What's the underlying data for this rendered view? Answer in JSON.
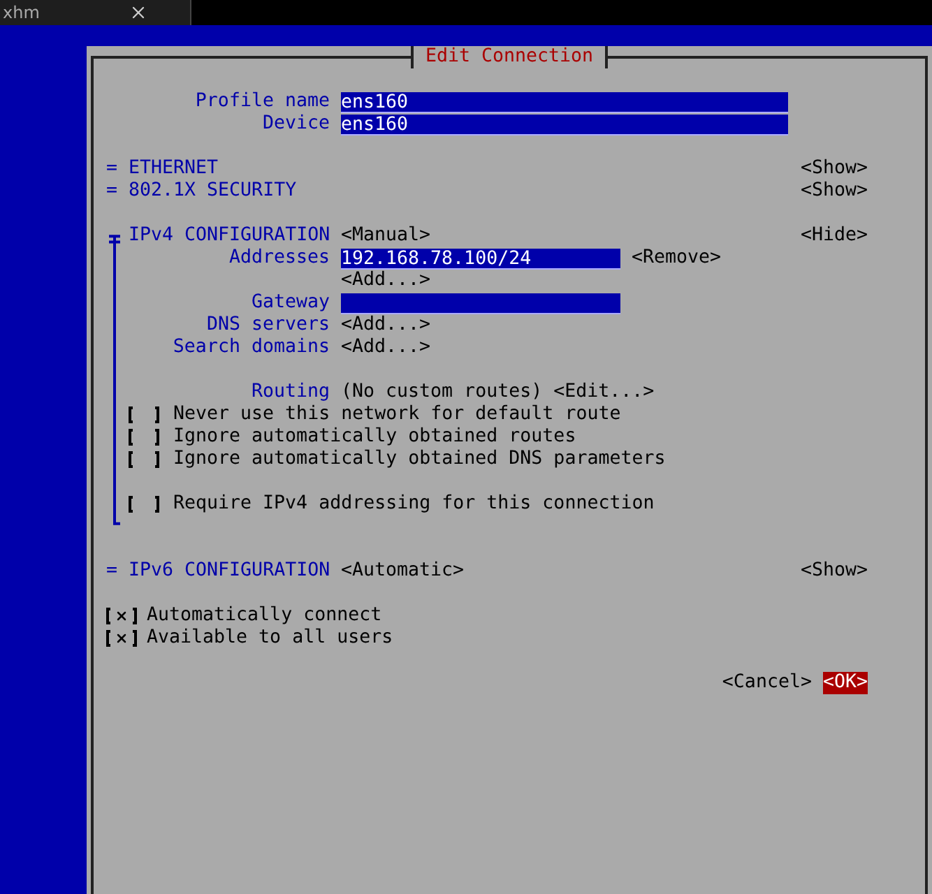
{
  "tab": {
    "title": "xhm"
  },
  "dialog": {
    "title": "Edit Connection",
    "fields": [
      {
        "label": "Profile name",
        "value": "ens160"
      },
      {
        "label": "Device",
        "value": "ens160"
      }
    ],
    "sections": [
      {
        "marker": "=",
        "title": "ETHERNET",
        "toggle": "<Show>",
        "expanded": false
      },
      {
        "marker": "=",
        "title": "802.1X SECURITY",
        "toggle": "<Show>",
        "expanded": false
      }
    ],
    "ipv4": {
      "title": "IPv4 CONFIGURATION",
      "mode": "<Manual>",
      "toggle": "<Hide>",
      "expanded": true,
      "addresses": {
        "label": "Addresses",
        "value": "192.168.78.100/24",
        "remove": "<Remove>",
        "add": "<Add...>"
      },
      "gateway": {
        "label": "Gateway"
      },
      "lists": [
        {
          "label": "DNS servers",
          "add": "<Add...>"
        },
        {
          "label": "Search domains",
          "add": "<Add...>"
        }
      ],
      "routing": {
        "label": "Routing",
        "value": "(No custom routes)",
        "edit": "<Edit...>"
      },
      "options": [
        {
          "label": "Never use this network for default route",
          "checked": false
        },
        {
          "label": "Ignore automatically obtained routes",
          "checked": false
        },
        {
          "label": "Ignore automatically obtained DNS parameters",
          "checked": false
        }
      ],
      "require": {
        "label": "Require IPv4 addressing for this connection",
        "checked": false
      }
    },
    "ipv6": {
      "marker": "=",
      "title": "IPv6 CONFIGURATION",
      "mode": "<Automatic>",
      "toggle": "<Show>",
      "expanded": false
    },
    "general": [
      {
        "label": "Automatically connect",
        "checked": true
      },
      {
        "label": "Available to all users",
        "checked": true
      }
    ],
    "buttons": [
      {
        "label": "<Cancel>",
        "focused": false
      },
      {
        "label": "<OK>",
        "focused": true
      }
    ]
  }
}
